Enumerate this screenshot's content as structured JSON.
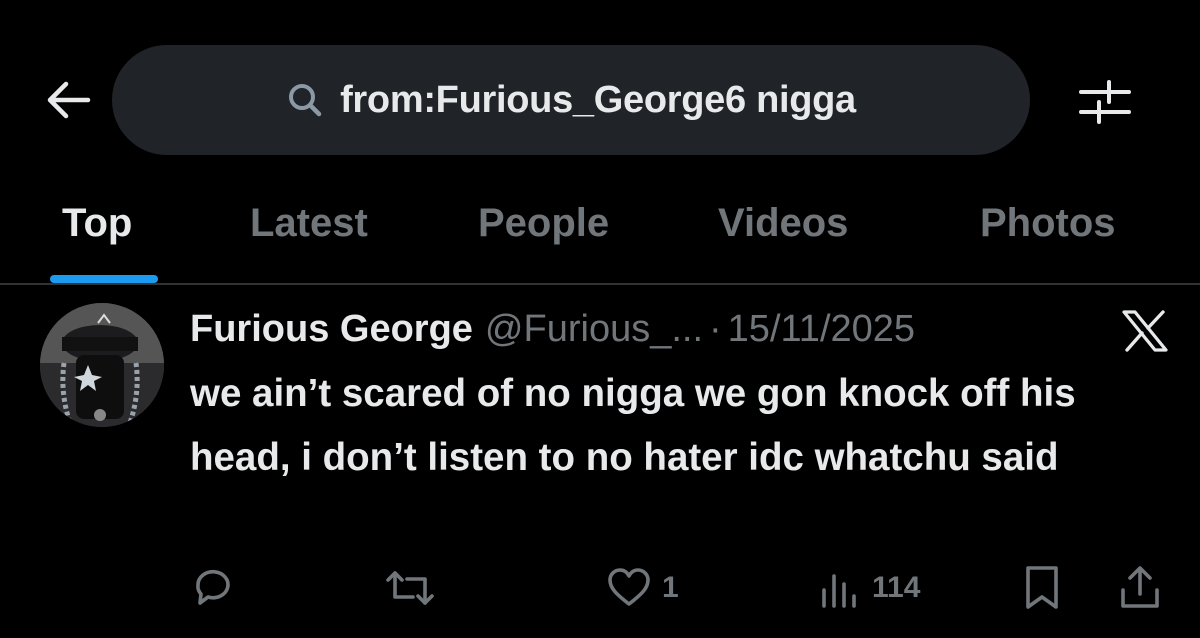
{
  "search": {
    "query": "from:Furious_George6 nigga"
  },
  "tabs": [
    {
      "label": "Top",
      "active": true
    },
    {
      "label": "Latest",
      "active": false
    },
    {
      "label": "People",
      "active": false
    },
    {
      "label": "Videos",
      "active": false
    },
    {
      "label": "Photos",
      "active": false
    }
  ],
  "tweet": {
    "display_name": "Furious George",
    "handle": "@Furious_...",
    "separator": "·",
    "date": "15/11/2025",
    "text": "we ain’t scared of no nigga we gon knock off his head, i don’t listen to no hater idc whatchu said",
    "likes": "1",
    "views": "114",
    "replies": "",
    "retweets": ""
  },
  "icons": {
    "back": "arrow-left-icon",
    "search": "search-icon",
    "filter": "sliders-icon",
    "logo": "x-logo-icon",
    "reply": "reply-icon",
    "retweet": "retweet-icon",
    "like": "heart-icon",
    "views": "views-icon",
    "bookmark": "bookmark-icon",
    "share": "share-icon"
  },
  "colors": {
    "background": "#000000",
    "text": "#e7e9ea",
    "muted": "#71767b",
    "accent": "#1d9bf0",
    "search_bg": "#202327"
  }
}
